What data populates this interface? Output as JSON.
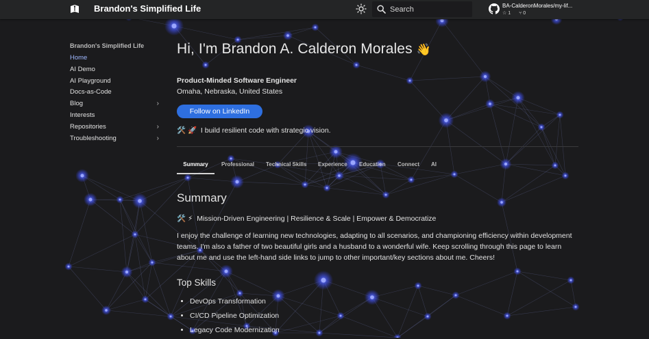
{
  "site": {
    "title": "Brandon's Simplified Life"
  },
  "navbar": {
    "logo_icon": "book-logo-icon",
    "theme_icon": "sun-icon",
    "search": {
      "placeholder": "Search",
      "icon": "search-icon"
    },
    "github": {
      "icon": "github-icon",
      "repo": "BA-CalderonMorales/my-lif...",
      "stars": "1",
      "forks": "0"
    }
  },
  "sidebar": {
    "title": "Brandon's Simplified Life",
    "items": [
      {
        "label": "Home",
        "active": true,
        "expandable": false
      },
      {
        "label": "AI Demo",
        "active": false,
        "expandable": false
      },
      {
        "label": "AI Playground",
        "active": false,
        "expandable": false
      },
      {
        "label": "Docs-as-Code",
        "active": false,
        "expandable": false
      },
      {
        "label": "Blog",
        "active": false,
        "expandable": true
      },
      {
        "label": "Interests",
        "active": false,
        "expandable": false
      },
      {
        "label": "Repositories",
        "active": false,
        "expandable": true
      },
      {
        "label": "Troubleshooting",
        "active": false,
        "expandable": true
      }
    ],
    "chevron": "›"
  },
  "main": {
    "greeting": "Hi, I'm Brandon A. Calderon Morales",
    "wave_emoji": "👋",
    "role": "Product-Minded Software Engineer",
    "location": "Omaha, Nebraska, United States",
    "linkedin_button": "Follow on LinkedIn",
    "tagline_emoji": "🛠️ 🚀",
    "tagline": "I build resilient code with strategic vision.",
    "tabs": [
      "Summary",
      "Professional",
      "Technical Skills",
      "Experience",
      "Education",
      "Connect",
      "AI"
    ],
    "active_tab": "Summary",
    "summary_heading": "Summary",
    "mission_emoji": "🛠️ ⚡",
    "mission": "Mission-Driven Engineering | Resilience & Scale | Empower & Democratize",
    "intro": "I enjoy the challenge of learning new technologies, adapting to all scenarios, and championing efficiency within development teams. I'm also a father of two beautiful girls and a husband to a wonderful wife. Keep scrolling through this page to learn about me and use the left-hand side links to jump to other important/key sections about me. Cheers!",
    "skills_heading": "Top Skills",
    "skills": [
      "DevOps Transformation",
      "CI/CD Pipeline Optimization",
      "Legacy Code Modernization"
    ]
  },
  "colors": {
    "background": "#1b1b1d",
    "navbar": "#242526",
    "accent": "#2e6fe0",
    "active_link": "#9fb8ff",
    "node_glow": "#4a5cff"
  }
}
